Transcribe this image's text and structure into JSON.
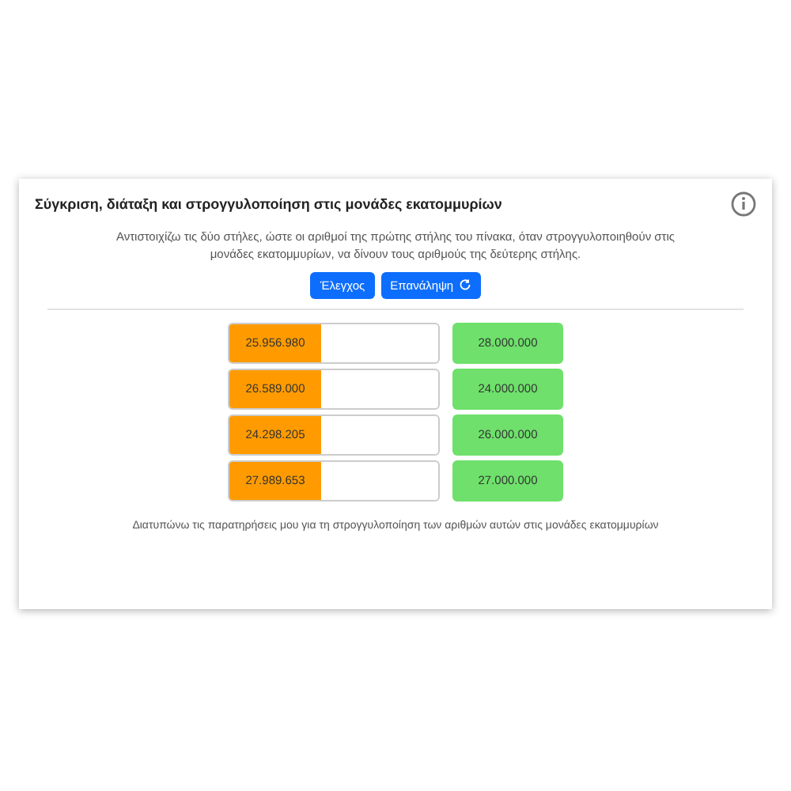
{
  "title": "Σύγκριση, διάταξη και στρογγυλοποίηση στις μονάδες εκατομμυρίων",
  "instruction": "Αντιστοιχίζω τις δύο στήλες, ώστε οι αριθμοί της πρώτης στήλης του πίνακα, όταν στρογγυλοποιηθούν στις μονάδες εκατομμυρίων, να δίνουν τους αριθμούς της δεύτερης στήλης.",
  "buttons": [
    {
      "label": "Έλεγχος",
      "kind": "check"
    },
    {
      "label": "Επανάληψη",
      "kind": "reset"
    }
  ],
  "numbers": [
    "25.956.980",
    "26.589.000",
    "24.298.205",
    "27.989.653"
  ],
  "targets": [
    "28.000.000",
    "24.000.000",
    "26.000.000",
    "27.000.000"
  ],
  "footer": "Διατυπώνω τις παρατηρήσεις μου για τη στρογγυλοποίηση των αριθμών αυτών στις μονάδες εκατομμυρίων"
}
